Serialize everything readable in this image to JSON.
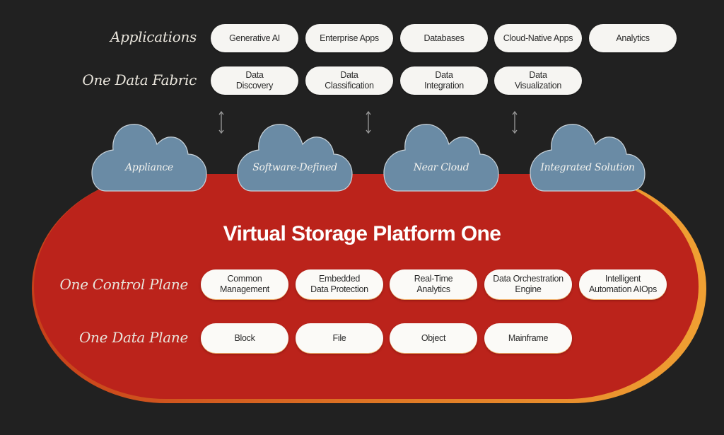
{
  "rows": {
    "applications": {
      "label": "Applications",
      "items": [
        "Generative AI",
        "Enterprise Apps",
        "Databases",
        "Cloud-Native Apps",
        "Analytics"
      ]
    },
    "data_fabric": {
      "label": "One Data Fabric",
      "items": [
        [
          "Data",
          "Discovery"
        ],
        [
          "Data",
          "Classification"
        ],
        [
          "Data",
          "Integration"
        ],
        [
          "Data",
          "Visualization"
        ]
      ]
    }
  },
  "deployment_clouds": [
    "Appliance",
    "Software-Defined",
    "Near Cloud",
    "Integrated Solution"
  ],
  "platform": {
    "title": "Virtual Storage Platform One",
    "control_plane": {
      "label": "One Control Plane",
      "items": [
        [
          "Common",
          "Management"
        ],
        [
          "Embedded",
          "Data Protection"
        ],
        [
          "Real-Time",
          "Analytics"
        ],
        [
          "Data Orchestration",
          "Engine"
        ],
        [
          "Intelligent",
          "Automation AIOps"
        ]
      ]
    },
    "data_plane": {
      "label": "One Data Plane",
      "items": [
        "Block",
        "File",
        "Object",
        "Mainframe"
      ]
    }
  },
  "colors": {
    "background": "#212121",
    "platform_red": "#bb231b",
    "platform_border": "#f0a033",
    "cloud_blue": "#6a8ba5",
    "pill": "#f6f5f2"
  }
}
